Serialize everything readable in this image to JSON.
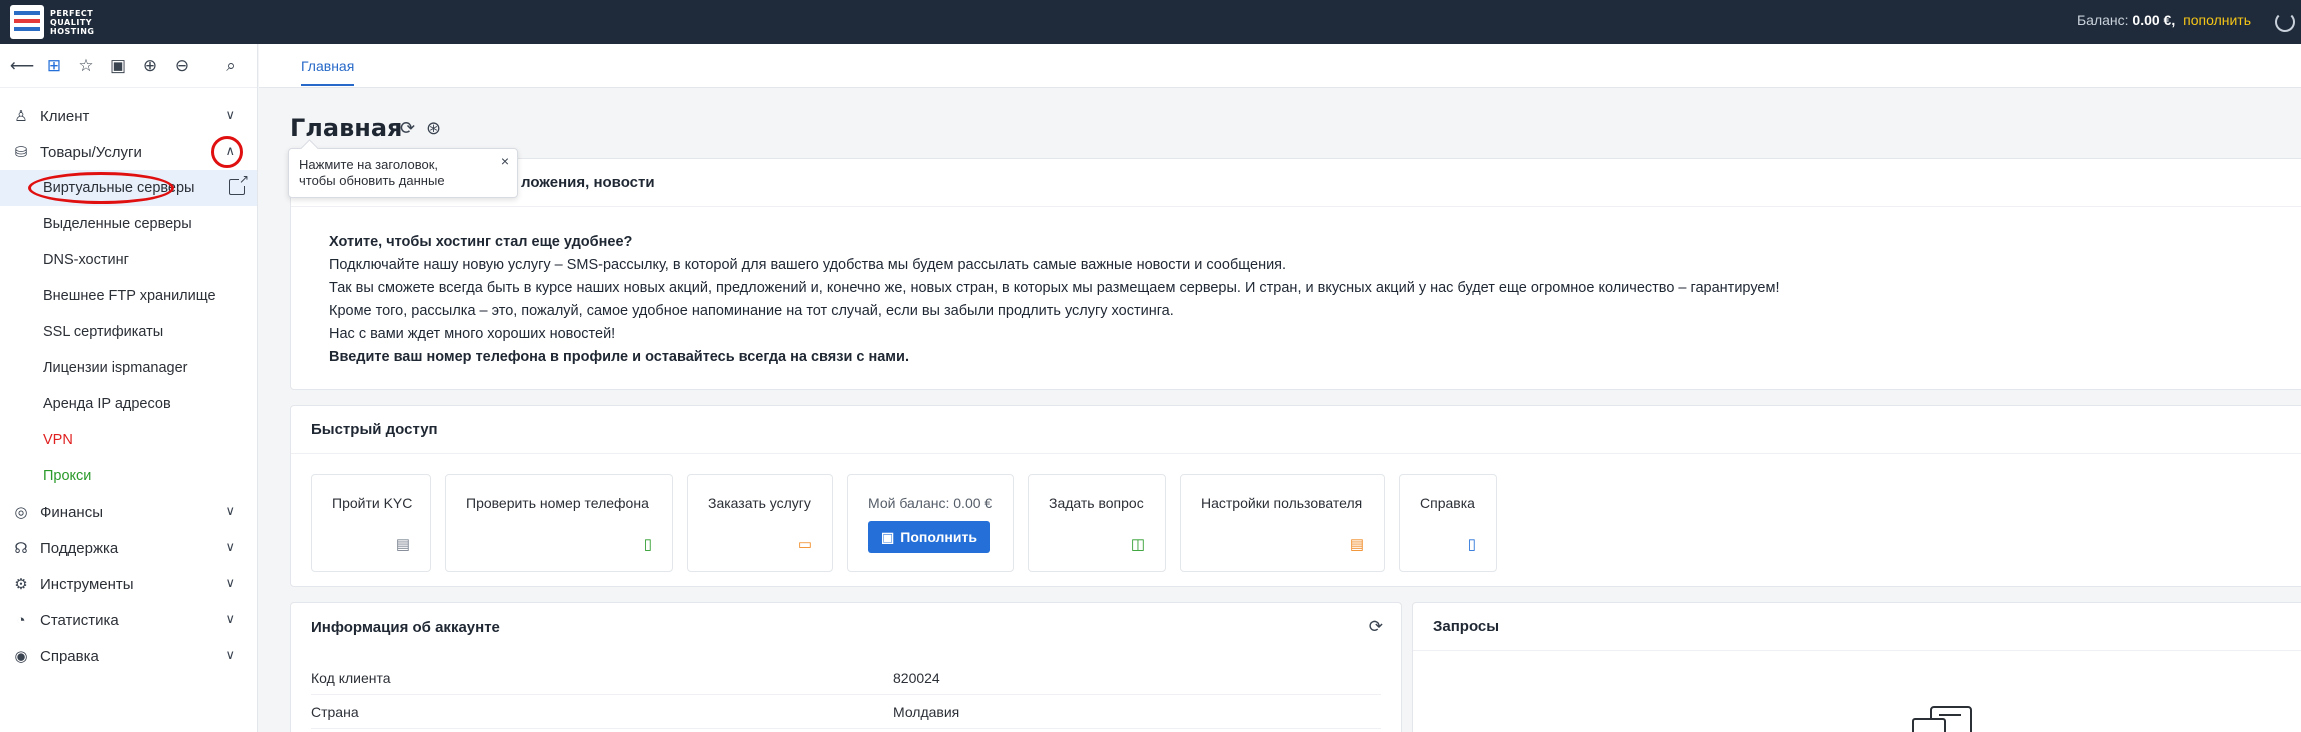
{
  "brand": {
    "logo_text": [
      "PERFECT",
      "QUALITY",
      "HOSTING"
    ],
    "accent": "#2570d8",
    "topbar_bg": "#1f2b3a"
  },
  "topbar": {
    "balance_label": "Баланс:",
    "balance_value": "0.00 €,",
    "topup_link": "пополнить",
    "refresh_icon": "refresh-icon"
  },
  "toolbar": {
    "icons": [
      "back-arrow-icon",
      "tree-icon",
      "star-icon",
      "briefcase-icon",
      "plus-circle-icon",
      "minus-circle-icon",
      "search-icon"
    ]
  },
  "sidebar": {
    "items": [
      {
        "label": "Клиент",
        "icon": "user-icon",
        "expanded": false
      },
      {
        "label": "Товары/Услуги",
        "icon": "basket-icon",
        "expanded": true,
        "children": [
          {
            "label": "Виртуальные серверы",
            "active": true
          },
          {
            "label": "Выделенные серверы"
          },
          {
            "label": "DNS-хостинг"
          },
          {
            "label": "Внешнее FTP хранилище"
          },
          {
            "label": "SSL сертификаты"
          },
          {
            "label": "Лицензии ispmanager"
          },
          {
            "label": "Аренда IP адресов"
          },
          {
            "label": "VPN",
            "color": "#e02020"
          },
          {
            "label": "Прокси",
            "color": "#2a9a2a"
          }
        ]
      },
      {
        "label": "Финансы",
        "icon": "coins-icon",
        "expanded": false
      },
      {
        "label": "Поддержка",
        "icon": "headset-icon",
        "expanded": false
      },
      {
        "label": "Инструменты",
        "icon": "gear-icon",
        "expanded": false
      },
      {
        "label": "Статистика",
        "icon": "chart-icon",
        "expanded": false
      },
      {
        "label": "Справка",
        "icon": "lifebuoy-icon",
        "expanded": false
      }
    ]
  },
  "tabs": [
    {
      "label": "Главная",
      "active": true
    }
  ],
  "page": {
    "title": "Главная",
    "tooltip": {
      "line1": "Нажмите на заголовок,",
      "line2": "чтобы обновить данные",
      "close": "×"
    }
  },
  "news": {
    "header": "Предложения, новости",
    "header_visible": "ложения, новости",
    "lines": [
      {
        "text": "Хотите, чтобы хостинг стал еще удобнее?",
        "bold": true
      },
      {
        "text": "Подключайте нашу новую услугу – SMS-рассылку, в которой для вашего удобства мы будем рассылать самые важные новости и сообщения."
      },
      {
        "text": "Так вы сможете всегда быть в курсе наших новых акций, предложений и, конечно же, новых стран, в которых мы размещаем серверы. И стран, и вкусных акций у нас будет еще огромное количество – гарантируем!"
      },
      {
        "text": "Кроме того, рассылка – это, пожалуй, самое удобное напоминание на тот случай, если вы забыли продлить услугу хостинга."
      },
      {
        "text": "Нас с вами ждет много хороших новостей!"
      },
      {
        "text": "Введите ваш номер телефона в профиле и оставайтесь всегда на связи с нами.",
        "bold": true
      }
    ]
  },
  "quick_access": {
    "header": "Быстрый доступ",
    "tiles": [
      {
        "label": "Пройти KYC",
        "icon": "id-card-icon",
        "icon_color": "#7a8290"
      },
      {
        "label": "Проверить номер телефона",
        "icon": "phone-check-icon",
        "icon_color": "#2a9a2a"
      },
      {
        "label": "Заказать услугу",
        "icon": "bag-icon",
        "icon_color": "#f08a24"
      },
      {
        "label": "Мой баланс: 0.00 €",
        "button": "Пополнить",
        "icon": "wallet-icon"
      },
      {
        "label": "Задать вопрос",
        "icon": "chat-icon",
        "icon_color": "#2a9a2a"
      },
      {
        "label": "Настройки пользователя",
        "icon": "settings-card-icon",
        "icon_color": "#f08a24"
      },
      {
        "label": "Справка",
        "icon": "document-icon",
        "icon_color": "#2570d8"
      }
    ]
  },
  "account": {
    "header": "Информация об аккаунте",
    "rows": [
      {
        "key": "Код клиента",
        "value": "820024"
      },
      {
        "key": "Страна",
        "value": "Молдавия"
      }
    ]
  },
  "requests": {
    "header": "Запросы"
  }
}
